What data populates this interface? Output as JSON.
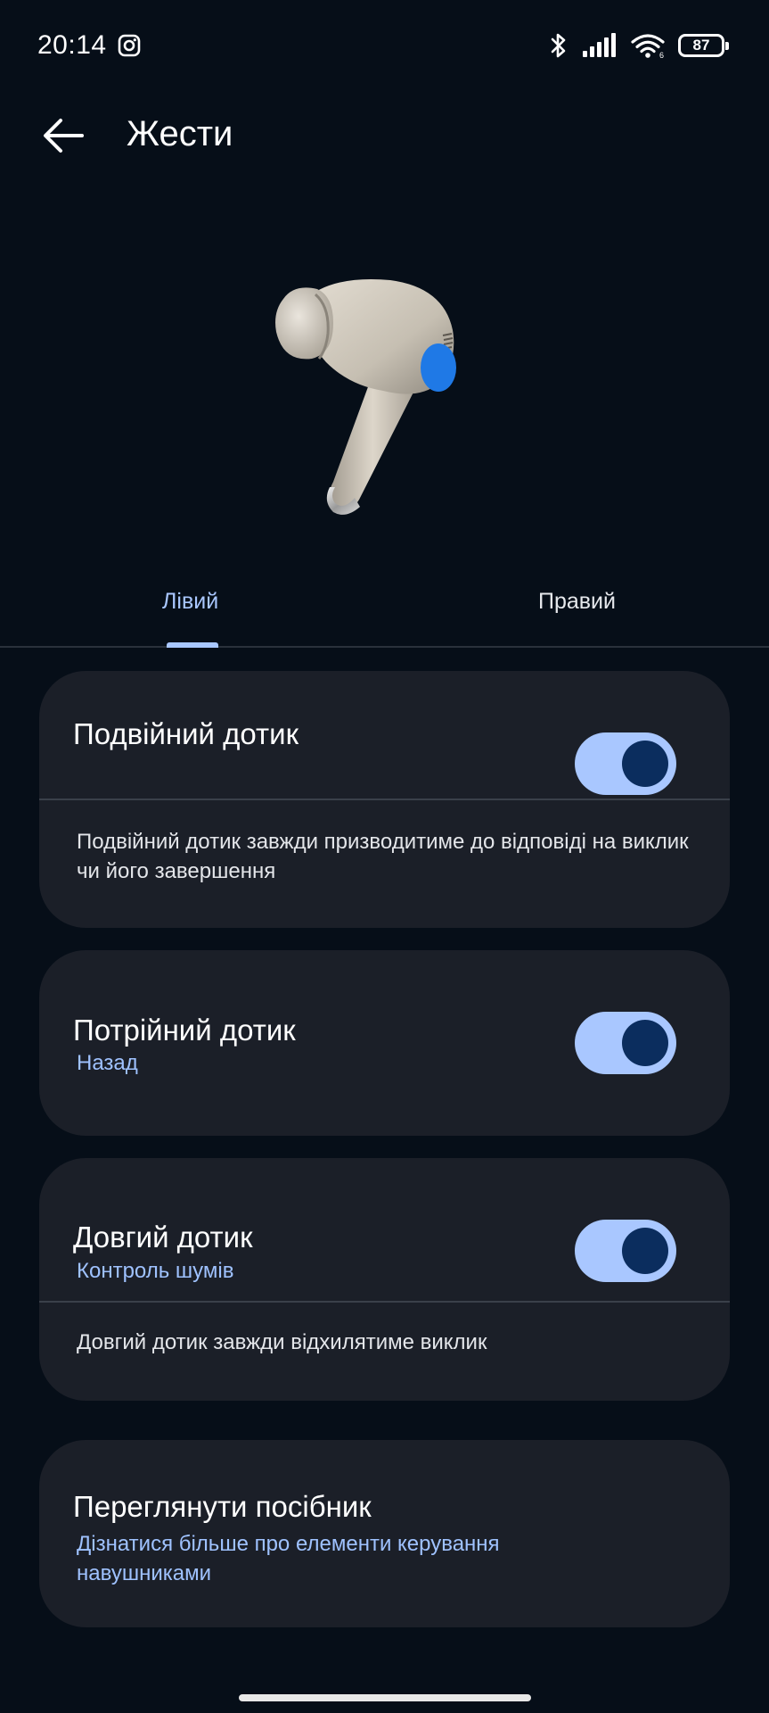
{
  "status_bar": {
    "time": "20:14",
    "battery": "87",
    "icons": [
      "instagram-icon",
      "bluetooth-icon",
      "signal-icon",
      "wifi-icon",
      "battery-icon"
    ]
  },
  "header": {
    "title": "Жести"
  },
  "tabs": [
    {
      "label": "Лівий",
      "selected": true
    },
    {
      "label": "Правий",
      "selected": false
    }
  ],
  "gestures": {
    "double_tap": {
      "title": "Подвійний дотик",
      "enabled": true,
      "note": "Подвійний дотик завжди призводитиме до відповіді на виклик чи його завершення"
    },
    "triple_tap": {
      "title": "Потрійний дотик",
      "action": "Назад",
      "enabled": true
    },
    "long_tap": {
      "title": "Довгий дотик",
      "action": "Контроль шумів",
      "enabled": true,
      "note": "Довгий дотик завжди відхилятиме виклик"
    }
  },
  "guide": {
    "title": "Переглянути посібник",
    "subtitle": "Дізнатися більше про елементи керування навушниками"
  },
  "colors": {
    "background": "#060e18",
    "card": "#1b1f28",
    "accent": "#a9c7ff",
    "toggle_knob": "#0b2d5e",
    "tap_zone": "#1f79e6"
  }
}
